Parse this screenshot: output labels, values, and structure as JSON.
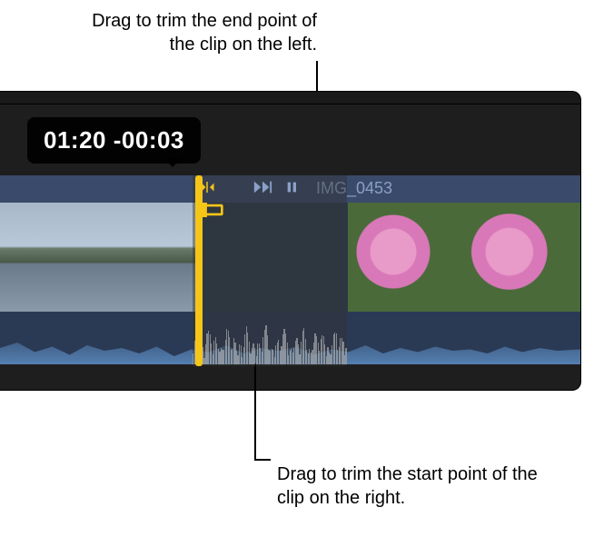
{
  "callouts": {
    "top": "Drag to trim the end point of the clip on the left.",
    "bottom": "Drag to trim the start point of the clip on the right."
  },
  "tooltip": {
    "position": "01:20",
    "delta": "-00:03"
  },
  "clip": {
    "right_name": "IMG_0453"
  },
  "icons": {
    "trim_arrows": "trim-arrows-icon",
    "skip_end": "skip-to-end-icon",
    "pause": "pause-icon",
    "bracket": "filmstrip-bracket-icon"
  },
  "colors": {
    "handle": "#f5c518",
    "label": "#8aa0c8",
    "bg": "#1e1e1e"
  }
}
